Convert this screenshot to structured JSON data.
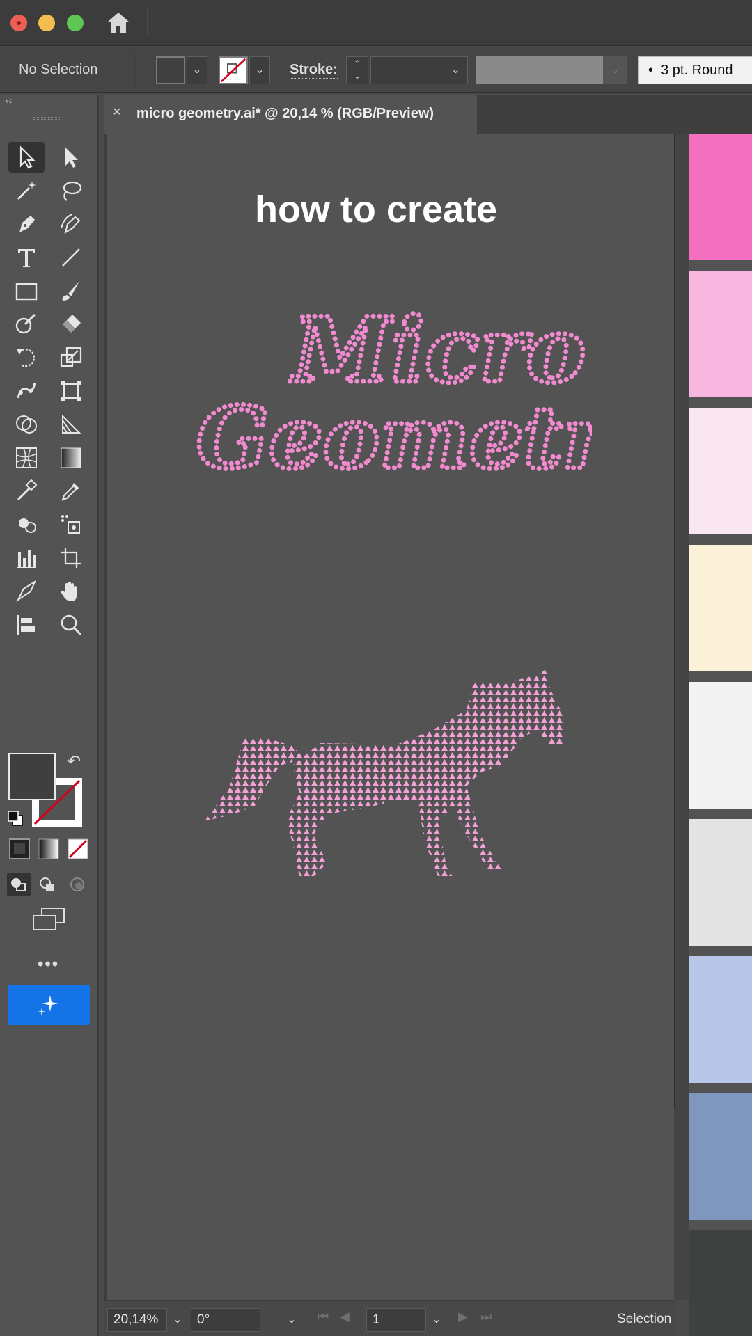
{
  "window": {
    "title_controls": [
      "close",
      "minimize",
      "zoom"
    ]
  },
  "control_bar": {
    "selection_status": "No Selection",
    "stroke_label": "Stroke:",
    "brush_label": "3 pt. Round"
  },
  "document": {
    "tab_close": "×",
    "tab_title": "micro geometry.ai* @ 20,14 % (RGB/Preview)"
  },
  "canvas": {
    "headline": "how to create",
    "artwork_title_line1": "Micro",
    "artwork_title_line2": "Geometry",
    "accent_color": "#f28ad0"
  },
  "toolbar": {
    "collapse_label": "‹‹",
    "more_label": "•••",
    "tools": [
      "selection-tool",
      "direct-selection-tool",
      "magic-wand-tool",
      "lasso-tool",
      "pen-tool",
      "curvature-tool",
      "type-tool",
      "line-segment-tool",
      "rectangle-tool",
      "paintbrush-tool",
      "shaper-tool",
      "eraser-tool",
      "rotate-tool",
      "scale-tool",
      "puppet-warp-tool",
      "free-transform-tool",
      "shape-builder-tool",
      "perspective-grid-tool",
      "mesh-tool",
      "gradient-tool",
      "eyedropper-tool",
      "eyedropper-sample-tool",
      "symbol-sprayer-tool",
      "symbol-tool",
      "column-graph-tool",
      "artboard-tool",
      "slice-tool",
      "hand-tool",
      "toggle-tool",
      "zoom-tool"
    ]
  },
  "swatches": {
    "colors": [
      "#f46fc0",
      "#f7b7de",
      "#f9e6f1",
      "#fbf1d9",
      "#f3f3f3",
      "#e4e4e4",
      "#b8c6e8",
      "#7f97be",
      "#3f4040"
    ]
  },
  "status_bar": {
    "zoom": "20,14%",
    "rotation": "0°",
    "artboard": "1",
    "current_tool": "Selection"
  }
}
